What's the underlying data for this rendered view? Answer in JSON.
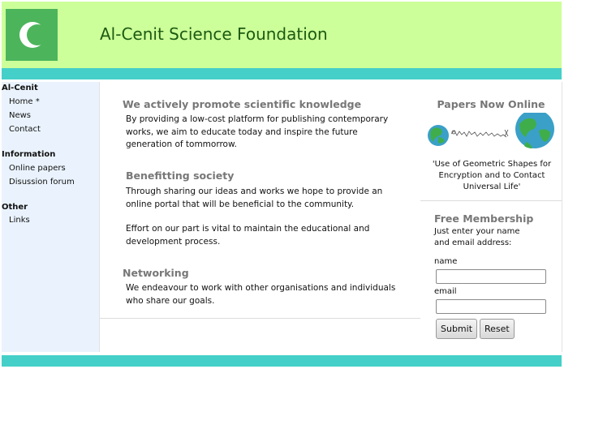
{
  "header": {
    "site_title": "Al-Cenit Science Foundation",
    "logo_icon": "crescent-moon-icon"
  },
  "sidebar": {
    "groups": [
      {
        "heading": "Al-Cenit",
        "items": [
          "Home *",
          "News",
          "Contact"
        ]
      },
      {
        "heading": "Information",
        "items": [
          "Online papers",
          "Disussion forum"
        ]
      },
      {
        "heading": "Other",
        "items": [
          "Links"
        ]
      }
    ]
  },
  "main": {
    "sections": [
      {
        "title": "We actively promote scientific knowledge",
        "paragraphs": [
          "By providing a low-cost platform for publishing contemporary works, we aim to educate today and inspire the future generation of tommorrow."
        ]
      },
      {
        "title": "Benefitting society",
        "paragraphs": [
          "Through sharing our ideas and works we hope to provide an online portal that will be beneficial to the community.",
          "Effort on our part is vital to maintain the educational and development process."
        ]
      },
      {
        "title": "Networking",
        "paragraphs": [
          "We endeavour to work with other organisations and individuals who share our goals."
        ]
      }
    ]
  },
  "papers": {
    "title": "Papers Now Online",
    "caption": "'Use of Geometric Shapes for Encryption and to Contact Universal Life'",
    "image_icon": "planets-signal-illustration"
  },
  "membership": {
    "title": "Free Membership",
    "intro_line1": "Just enter your name",
    "intro_line2": "and email address:",
    "name_label": "name",
    "name_value": "",
    "email_label": "email",
    "email_value": "",
    "submit_label": "Submit",
    "reset_label": "Reset"
  },
  "colors": {
    "header_bg": "#ccff99",
    "accent_band": "#44d0c8",
    "logo_bg": "#4cb55b",
    "sidebar_bg": "#eaf3fd"
  }
}
